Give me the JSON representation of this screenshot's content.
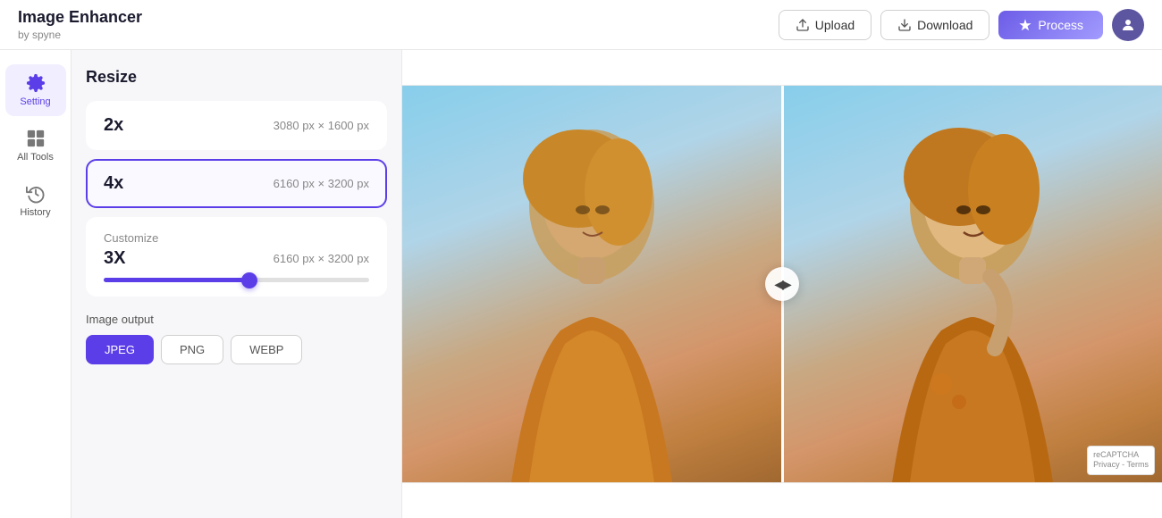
{
  "header": {
    "app_name": "Image Enhancer",
    "app_subtitle": "by spyne",
    "upload_label": "Upload",
    "download_label": "Download",
    "process_label": "Process",
    "avatar_icon": "person"
  },
  "sidebar": {
    "items": [
      {
        "id": "setting",
        "label": "Setting",
        "icon": "gear"
      },
      {
        "id": "all-tools",
        "label": "All Tools",
        "icon": "tools"
      },
      {
        "id": "history",
        "label": "History",
        "icon": "history"
      }
    ]
  },
  "panel": {
    "title": "Resize",
    "options": [
      {
        "id": "2x",
        "label": "2x",
        "dims": "3080 px × 1600 px"
      },
      {
        "id": "4x",
        "label": "4x",
        "dims": "6160 px × 3200 px"
      }
    ],
    "customize": {
      "title": "Customize",
      "value": "3X",
      "dims": "6160 px × 3200 px",
      "slider_percent": 55
    },
    "output": {
      "label": "Image output",
      "formats": [
        "JPEG",
        "PNG",
        "WEBP"
      ],
      "active_format": "JPEG"
    }
  },
  "recaptcha": {
    "line1": "reCAPTCHA",
    "line2": "Privacy - Terms"
  }
}
